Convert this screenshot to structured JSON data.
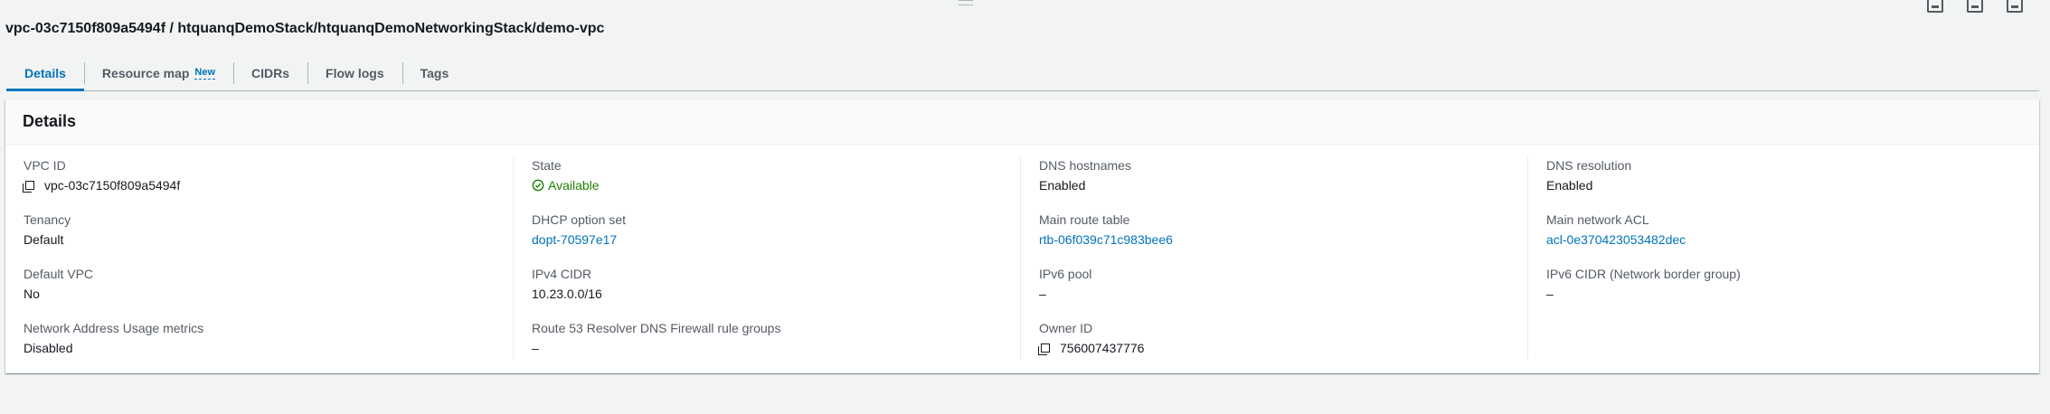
{
  "title": "vpc-03c7150f809a5494f / htquanqDemoStack/htquanqDemoNetworkingStack/demo-vpc",
  "tabs": [
    {
      "label": "Details"
    },
    {
      "label": "Resource map",
      "badge": "New"
    },
    {
      "label": "CIDRs"
    },
    {
      "label": "Flow logs"
    },
    {
      "label": "Tags"
    }
  ],
  "panel": {
    "heading": "Details",
    "columns": [
      [
        {
          "label": "VPC ID",
          "value": "vpc-03c7150f809a5494f"
        },
        {
          "label": "Tenancy",
          "value": "Default"
        },
        {
          "label": "Default VPC",
          "value": "No"
        },
        {
          "label": "Network Address Usage metrics",
          "value": "Disabled"
        }
      ],
      [
        {
          "label": "State",
          "value": "Available"
        },
        {
          "label": "DHCP option set",
          "value": "dopt-70597e17"
        },
        {
          "label": "IPv4 CIDR",
          "value": "10.23.0.0/16"
        },
        {
          "label": "Route 53 Resolver DNS Firewall rule groups",
          "value": "–"
        }
      ],
      [
        {
          "label": "DNS hostnames",
          "value": "Enabled"
        },
        {
          "label": "Main route table",
          "value": "rtb-06f039c71c983bee6"
        },
        {
          "label": "IPv6 pool",
          "value": "–"
        },
        {
          "label": "Owner ID",
          "value": "756007437776"
        }
      ],
      [
        {
          "label": "DNS resolution",
          "value": "Enabled"
        },
        {
          "label": "Main network ACL",
          "value": "acl-0e370423053482dec"
        },
        {
          "label": "IPv6 CIDR (Network border group)",
          "value": "–"
        }
      ]
    ]
  },
  "colors": {
    "link": "#0073bb",
    "success": "#1d8102"
  }
}
